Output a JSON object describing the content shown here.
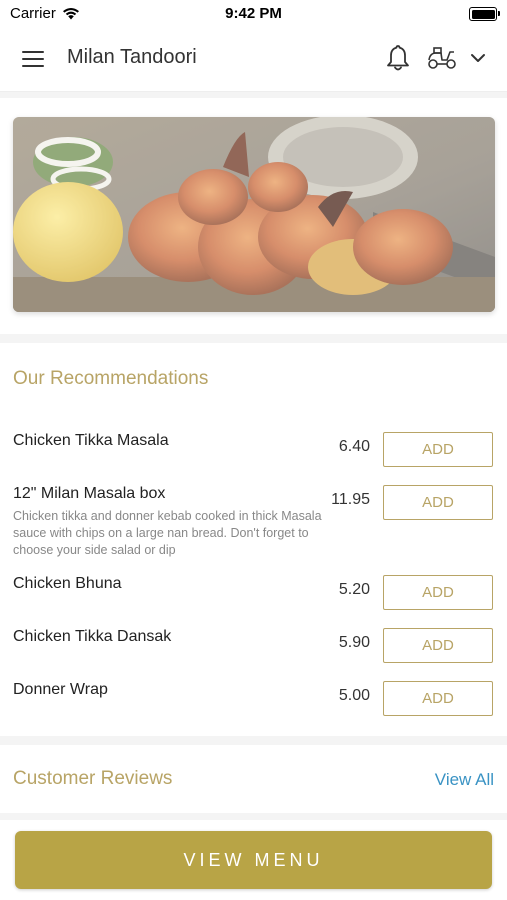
{
  "status_bar": {
    "carrier": "Carrier",
    "time": "9:42 PM"
  },
  "header": {
    "title": "Milan Tandoori",
    "menu_icon": "hamburger-menu-icon",
    "notification_icon": "bell-icon",
    "delivery_icon": "scooter-icon",
    "dropdown_icon": "chevron-down-icon"
  },
  "hero": {
    "image": "grilled-tandoori-prawns-with-lemon"
  },
  "recommendations": {
    "title": "Our Recommendations",
    "add_label": "ADD",
    "items": [
      {
        "name": "Chicken Tikka Masala",
        "description": "",
        "price": "6.40"
      },
      {
        "name": "12\" Milan Masala box",
        "description": "Chicken tikka and donner kebab cooked in thick Masala sauce with chips on a large nan bread. Don't forget to choose your side salad or dip",
        "price": "11.95"
      },
      {
        "name": "Chicken Bhuna",
        "description": "",
        "price": "5.20"
      },
      {
        "name": "Chicken Tikka Dansak",
        "description": "",
        "price": "5.90"
      },
      {
        "name": "Donner Wrap",
        "description": "",
        "price": "5.00"
      }
    ]
  },
  "reviews": {
    "title": "Customer Reviews",
    "view_all": "View All"
  },
  "footer": {
    "view_menu": "VIEW MENU"
  },
  "colors": {
    "accent_gold": "#b8a446",
    "link_blue": "#3a93c4"
  }
}
